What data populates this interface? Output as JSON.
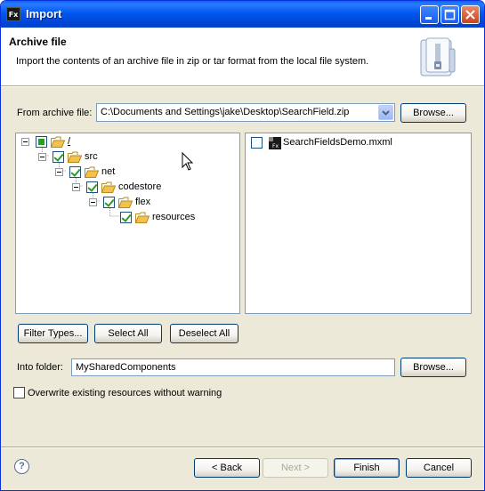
{
  "window": {
    "title": "Import",
    "app_icon_label": "Fx"
  },
  "header": {
    "title": "Archive file",
    "description": "Import the contents of an archive file in zip or tar format from the local file system.",
    "banner_icon": "archive-file-icon"
  },
  "archive": {
    "label": "From archive file:",
    "value": "C:\\Documents and Settings\\jake\\Desktop\\SearchField.zip",
    "browse_label": "Browse..."
  },
  "tree": {
    "items": [
      {
        "label": "/",
        "level": 0,
        "state": "partial"
      },
      {
        "label": "src",
        "level": 1,
        "state": "checked"
      },
      {
        "label": "net",
        "level": 2,
        "state": "checked"
      },
      {
        "label": "codestore",
        "level": 3,
        "state": "checked"
      },
      {
        "label": "flex",
        "level": 4,
        "state": "checked"
      },
      {
        "label": "resources",
        "level": 5,
        "state": "checked"
      }
    ]
  },
  "files": {
    "items": [
      {
        "label": "SearchFieldsDemo.mxml",
        "icon": "mxml-file-icon",
        "checked": false
      }
    ]
  },
  "buttons": {
    "filter_types": "Filter Types...",
    "select_all": "Select All",
    "deselect_all": "Deselect All"
  },
  "folder": {
    "label": "Into folder:",
    "value": "MySharedComponents",
    "browse_label": "Browse..."
  },
  "overwrite": {
    "label": "Overwrite existing resources without warning",
    "checked": false
  },
  "footer": {
    "back": "< Back",
    "next": "Next >",
    "finish": "Finish",
    "cancel": "Cancel",
    "help_icon_text": "?"
  },
  "colors": {
    "titlebar": "#0058ee",
    "dialog_bg": "#ece9d8",
    "check": "#21a121",
    "folder": "#f2c14e"
  }
}
